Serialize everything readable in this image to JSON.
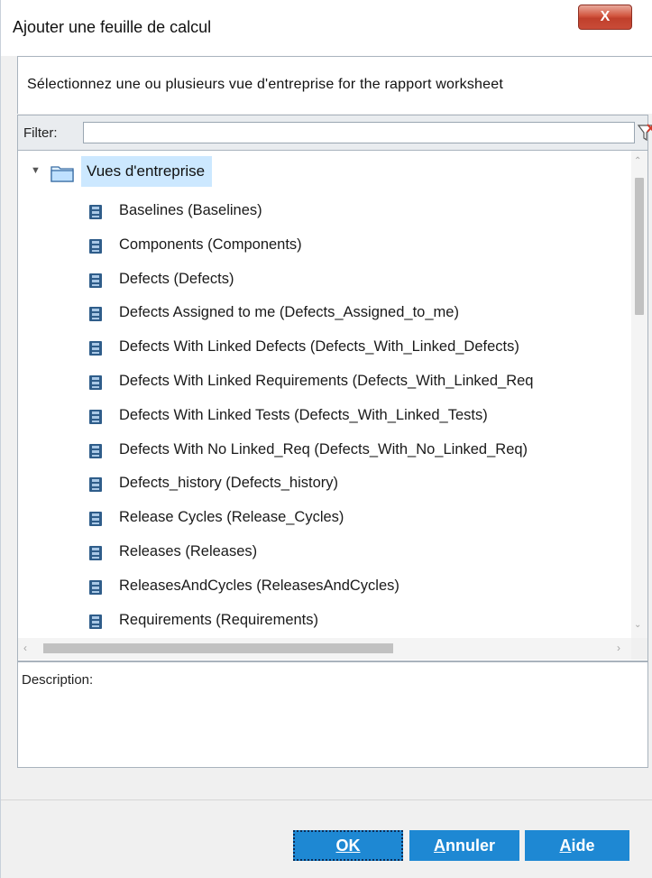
{
  "window": {
    "title": "Ajouter une feuille de calcul",
    "close_glyph": "X"
  },
  "instruction": "Sélectionnez une ou plusieurs vue d'entreprise for the rapport worksheet",
  "filter": {
    "label": "Filter:",
    "value": "",
    "icon": "filter-clear-icon"
  },
  "tree": {
    "root": {
      "label": "Vues d'entreprise",
      "expanded": true,
      "icon": "folder-icon"
    },
    "items": [
      {
        "label": "Baselines (Baselines)"
      },
      {
        "label": "Components (Components)"
      },
      {
        "label": "Defects (Defects)"
      },
      {
        "label": "Defects Assigned to me (Defects_Assigned_to_me)"
      },
      {
        "label": "Defects With Linked Defects (Defects_With_Linked_Defects)"
      },
      {
        "label": "Defects With Linked Requirements (Defects_With_Linked_Req"
      },
      {
        "label": "Defects With Linked Tests (Defects_With_Linked_Tests)"
      },
      {
        "label": "Defects With No Linked_Req (Defects_With_No_Linked_Req)"
      },
      {
        "label": "Defects_history (Defects_history)"
      },
      {
        "label": "Release Cycles (Release_Cycles)"
      },
      {
        "label": "Releases (Releases)"
      },
      {
        "label": "ReleasesAndCycles (ReleasesAndCycles)"
      },
      {
        "label": "Requirements (Requirements)"
      }
    ],
    "item_icon": "database-icon"
  },
  "description": {
    "label": "Description:",
    "value": ""
  },
  "buttons": {
    "ok": {
      "label": "OK"
    },
    "cancel": {
      "label": "Annuler"
    },
    "help": {
      "label": "Aide"
    }
  },
  "colors": {
    "accent_button": "#1e88d3",
    "selection_highlight": "#cce8ff",
    "close_button": "#c94b38"
  }
}
